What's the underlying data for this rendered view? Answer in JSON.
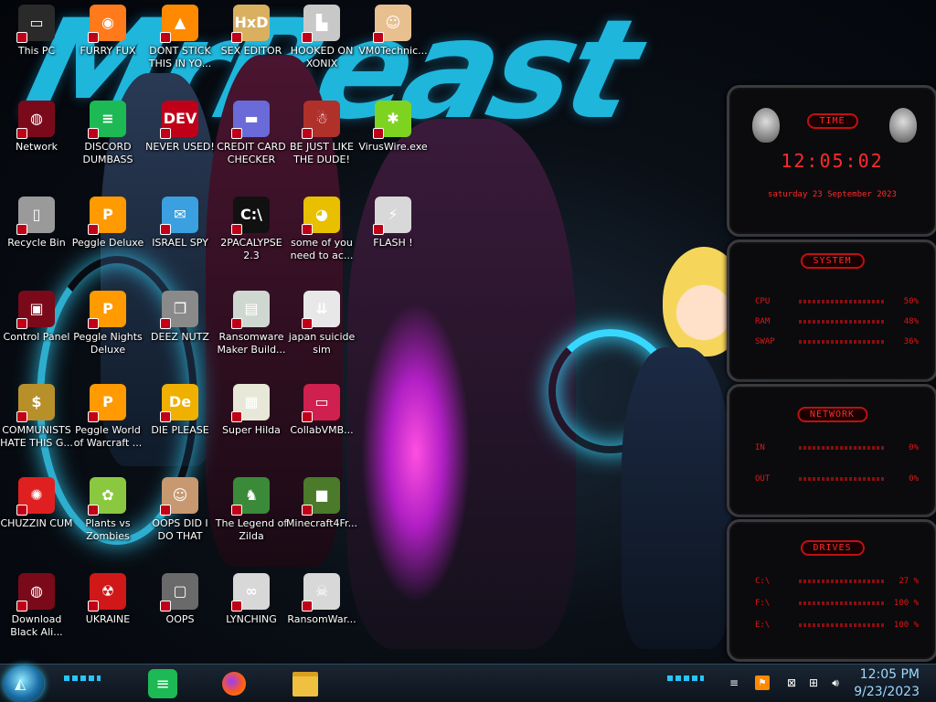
{
  "desktop": {
    "wallpaper_text": "MrBeast",
    "icons": [
      {
        "label": "This PC",
        "icon": "computer-icon",
        "color": "#2a2a2a",
        "glyph": "▭"
      },
      {
        "label": "FURRY FUX",
        "icon": "firefox-icon",
        "color": "#ff7a1a",
        "glyph": "◉"
      },
      {
        "label": "DONT STICK THIS IN YO...",
        "icon": "vlc-cone-icon",
        "color": "#ff8a00",
        "glyph": "▲"
      },
      {
        "label": "SEX EDITOR",
        "icon": "hxd-icon",
        "color": "#d8b060",
        "glyph": "HxD"
      },
      {
        "label": "HOOKED ON XONIX",
        "icon": "xonix-icon",
        "color": "#c8c8c8",
        "glyph": "▙"
      },
      {
        "label": "VM0Technic...",
        "icon": "doctor-icon",
        "color": "#e8c090",
        "glyph": "☺"
      },
      {
        "label": "Network",
        "icon": "alien-network-icon",
        "color": "#7a0a1a",
        "glyph": "◍"
      },
      {
        "label": "DISCORD DUMBASS",
        "icon": "chat-icon",
        "color": "#1db954",
        "glyph": "≡"
      },
      {
        "label": "NEVER USED!",
        "icon": "devcpp-icon",
        "color": "#c00018",
        "glyph": "DEV"
      },
      {
        "label": "CREDIT CARD CHECKER",
        "icon": "credit-card-icon",
        "color": "#6a6ad8",
        "glyph": "▬"
      },
      {
        "label": "BE JUST LIKE THE DUDE!",
        "icon": "santa-icon",
        "color": "#b0302a",
        "glyph": "☃"
      },
      {
        "label": "VirusWire.exe",
        "icon": "lime-icon",
        "color": "#7ed321",
        "glyph": "✱"
      },
      {
        "label": "Recycle Bin",
        "icon": "recycle-bin-icon",
        "color": "#9a9a9a",
        "glyph": "▯"
      },
      {
        "label": "Peggle Deluxe",
        "icon": "peggle-icon",
        "color": "#ff9a00",
        "glyph": "P"
      },
      {
        "label": "ISRAEL SPY",
        "icon": "spy-icon",
        "color": "#3aa0e0",
        "glyph": "✉"
      },
      {
        "label": "2PACALYPSE 2.3",
        "icon": "terminal-icon",
        "color": "#111111",
        "glyph": "C:\\"
      },
      {
        "label": "some of you need to ac...",
        "icon": "dog-icon",
        "color": "#e8c000",
        "glyph": "◕"
      },
      {
        "label": "FLASH !",
        "icon": "flash-icon",
        "color": "#d8d8d8",
        "glyph": "⚡"
      },
      {
        "label": "Control Panel",
        "icon": "control-panel-icon",
        "color": "#7a0a1a",
        "glyph": "▣"
      },
      {
        "label": "Peggle Nights Deluxe",
        "icon": "peggle-nights-icon",
        "color": "#ff9a00",
        "glyph": "P"
      },
      {
        "label": "DEEZ NUTZ",
        "icon": "windows-stack-icon",
        "color": "#8a8a8a",
        "glyph": "❐"
      },
      {
        "label": "Ransomware Maker Build...",
        "icon": "window-app-icon",
        "color": "#cfd8d0",
        "glyph": "▤"
      },
      {
        "label": "japan suicide sim",
        "icon": "file-icon",
        "color": "#e8e8e8",
        "glyph": "⇊"
      },
      {
        "label": "COMMUNISTS HATE THIS G...",
        "icon": "money-bag-icon",
        "color": "#b8902a",
        "glyph": "$"
      },
      {
        "label": "Peggle World of Warcraft ...",
        "icon": "peggle-wow-icon",
        "color": "#ff9a00",
        "glyph": "P"
      },
      {
        "label": "DIE PLEASE",
        "icon": "de-icon",
        "color": "#f0b000",
        "glyph": "De"
      },
      {
        "label": "Super Hilda",
        "icon": "pixel-icon",
        "color": "#e8e8d8",
        "glyph": "▦"
      },
      {
        "label": "CollabVMB...",
        "icon": "collabvm-icon",
        "color": "#d02050",
        "glyph": "▭"
      },
      {
        "label": "CHUZZIN CUM",
        "icon": "chuzzle-icon",
        "color": "#e02020",
        "glyph": "✺"
      },
      {
        "label": "Plants vs Zombies",
        "icon": "plant-icon",
        "color": "#8ac840",
        "glyph": "✿"
      },
      {
        "label": "OOPS DID I DO THAT",
        "icon": "portrait-icon",
        "color": "#c89870",
        "glyph": "☺"
      },
      {
        "label": "The Legend of Zilda",
        "icon": "zelda-icon",
        "color": "#3a8a3a",
        "glyph": "♞"
      },
      {
        "label": "Minecraft4Fr...",
        "icon": "minecraft-icon",
        "color": "#4a7a2a",
        "glyph": "■"
      },
      {
        "label": "Download Black Ali...",
        "icon": "alien-icon",
        "color": "#7a0a1a",
        "glyph": "◍"
      },
      {
        "label": "UKRAINE",
        "icon": "radiation-icon",
        "color": "#d01818",
        "glyph": "☢"
      },
      {
        "label": "OOPS",
        "icon": "frame-icon",
        "color": "#6a6a6a",
        "glyph": "▢"
      },
      {
        "label": "LYNCHING",
        "icon": "rope-icon",
        "color": "#d8d8d8",
        "glyph": "∞"
      },
      {
        "label": "RansomWar...",
        "icon": "skull-icon",
        "color": "#d8d8d8",
        "glyph": "☠"
      }
    ]
  },
  "gadgets": {
    "time": {
      "title": "TIME",
      "clock": "12:05:02",
      "date": "saturday 23 September 2023"
    },
    "system": {
      "title": "SYSTEM",
      "rows": [
        {
          "key": "CPU",
          "value": "50%"
        },
        {
          "key": "RAM",
          "value": "48%"
        },
        {
          "key": "SWAP",
          "value": "36%"
        }
      ]
    },
    "network": {
      "title": "NETWORK",
      "rows": [
        {
          "key": "IN",
          "value": "0%"
        },
        {
          "key": "OUT",
          "value": "0%"
        }
      ]
    },
    "drives": {
      "title": "DRIVES",
      "rows": [
        {
          "key": "C:\\",
          "value": "27 %"
        },
        {
          "key": "F:\\",
          "value": "100 %"
        },
        {
          "key": "E:\\",
          "value": "100 %"
        }
      ]
    }
  },
  "taskbar": {
    "pinned": [
      "chat-icon",
      "firefox-icon",
      "file-explorer-icon"
    ],
    "tray": [
      "show-desktop-icon",
      "flag-icon",
      "action-center-icon",
      "network-icon",
      "volume-icon"
    ],
    "time": "12:05 PM",
    "date": "9/23/2023"
  }
}
